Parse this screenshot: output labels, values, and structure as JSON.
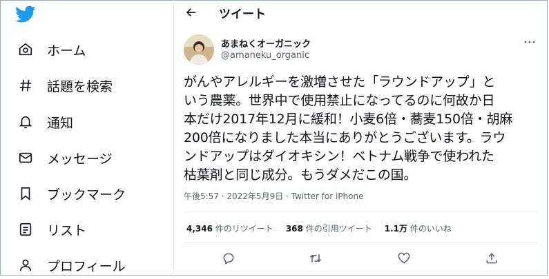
{
  "sidebar": {
    "items": [
      {
        "label": "ホーム",
        "icon": "home-icon"
      },
      {
        "label": "話題を検索",
        "icon": "hashtag-icon"
      },
      {
        "label": "通知",
        "icon": "bell-icon"
      },
      {
        "label": "メッセージ",
        "icon": "mail-icon"
      },
      {
        "label": "ブックマーク",
        "icon": "bookmark-icon"
      },
      {
        "label": "リスト",
        "icon": "list-icon"
      },
      {
        "label": "プロフィール",
        "icon": "profile-icon"
      }
    ]
  },
  "header": {
    "title": "ツイート"
  },
  "tweet": {
    "display_name": "あまねくオーガニック",
    "handle": "@amaneku_organic",
    "text": "がんやアレルギーを激増させた「ラウンドアップ」と\nいう農薬。世界中で使用禁止になってるのに何故か日\n本だけ2017年12月に緩和！小麦6倍・蕎麦150倍・胡麻\n200倍になりました本当にありがとうございます。ラウ\nンドアップはダイオキシン！ベトナム戦争で使われた\n枯葉剤と同じ成分。もうダメだこの国。",
    "meta": "午後5:57 · 2022年5月9日 · Twitter for iPhone",
    "stats": {
      "retweets_count": "4,346",
      "retweets_label": "件のリツイート",
      "quotes_count": "368",
      "quotes_label": "件の引用ツイート",
      "likes_count": "1.1万",
      "likes_label": "件のいいね"
    }
  },
  "colors": {
    "brand": "#1d9bf0",
    "text": "#0f1419",
    "muted": "#536471",
    "border": "#e6ecf0"
  }
}
